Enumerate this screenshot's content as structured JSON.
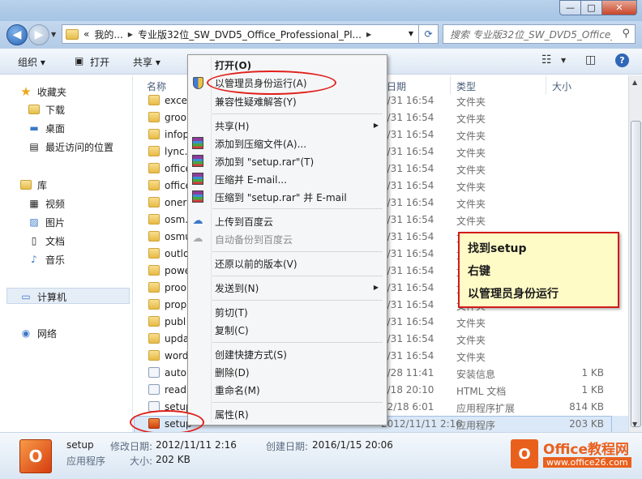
{
  "window": {
    "min": "—",
    "max": "□",
    "close": "✕"
  },
  "address": {
    "crumbs": [
      "«",
      "我的...",
      "专业版32位_SW_DVD5_Office_Professional_Pl..."
    ],
    "search_placeholder": "搜索 专业版32位_SW_DVD5_Office_..."
  },
  "toolbar": {
    "organize": "组织 ▾",
    "open": "打开",
    "share": "共享 ▾"
  },
  "sidebar": {
    "favorites": "收藏夹",
    "downloads": "下载",
    "desktop": "桌面",
    "recent": "最近访问的位置",
    "libraries": "库",
    "videos": "视频",
    "pictures": "图片",
    "documents": "文档",
    "music": "音乐",
    "computer": "计算机",
    "network": "网络"
  },
  "columns": {
    "name": "名称",
    "date": "日期",
    "type": "类型",
    "size": "大小"
  },
  "files": [
    {
      "name": "exce",
      "date": "1/31 16:54",
      "type": "文件夹",
      "size": ""
    },
    {
      "name": "groo",
      "date": "1/31 16:54",
      "type": "文件夹",
      "size": ""
    },
    {
      "name": "infop",
      "date": "1/31 16:54",
      "type": "文件夹",
      "size": ""
    },
    {
      "name": "lync.",
      "date": "1/31 16:54",
      "type": "文件夹",
      "size": ""
    },
    {
      "name": "office",
      "date": "1/31 16:54",
      "type": "文件夹",
      "size": ""
    },
    {
      "name": "office",
      "date": "1/31 16:54",
      "type": "文件夹",
      "size": ""
    },
    {
      "name": "oner",
      "date": "1/31 16:54",
      "type": "文件夹",
      "size": ""
    },
    {
      "name": "osm.",
      "date": "1/31 16:54",
      "type": "文件夹",
      "size": ""
    },
    {
      "name": "osmu",
      "date": "1/31 16:54",
      "type": "文件夹",
      "size": ""
    },
    {
      "name": "outlo",
      "date": "1/31 16:54",
      "type": "文件夹",
      "size": ""
    },
    {
      "name": "powe",
      "date": "1/31 16:54",
      "type": "文件夹",
      "size": ""
    },
    {
      "name": "proo",
      "date": "1/31 16:54",
      "type": "文件夹",
      "size": ""
    },
    {
      "name": "prop",
      "date": "1/31 16:54",
      "type": "文件夹",
      "size": ""
    },
    {
      "name": "publ",
      "date": "1/31 16:54",
      "type": "文件夹",
      "size": ""
    },
    {
      "name": "upda",
      "date": "1/31 16:54",
      "type": "文件夹",
      "size": ""
    },
    {
      "name": "word",
      "date": "1/31 16:54",
      "type": "文件夹",
      "size": ""
    },
    {
      "name": "autor",
      "date": "3/28 11:41",
      "type": "安装信息",
      "size": "1 KB"
    },
    {
      "name": "read",
      "date": "3/18 20:10",
      "type": "HTML 文档",
      "size": "1 KB"
    },
    {
      "name": "setup",
      "date": "12/18 6:01",
      "type": "应用程序扩展",
      "size": "814 KB"
    },
    {
      "name": "setup",
      "date": "2012/11/11 2:16",
      "type": "应用程序",
      "size": "203 KB"
    }
  ],
  "context_menu": {
    "open": "打开(O)",
    "run_as_admin": "以管理员身份运行(A)",
    "troubleshoot": "兼容性疑难解答(Y)",
    "share": "共享(H)",
    "add_archive": "添加到压缩文件(A)...",
    "add_setup_rar": "添加到 \"setup.rar\"(T)",
    "compress_email": "压缩并 E-mail...",
    "compress_setup_email": "压缩到 \"setup.rar\" 并 E-mail",
    "upload_baidu": "上传到百度云",
    "backup_baidu": "自动备份到百度云",
    "restore": "还原以前的版本(V)",
    "send_to": "发送到(N)",
    "cut": "剪切(T)",
    "copy": "复制(C)",
    "shortcut": "创建快捷方式(S)",
    "delete": "删除(D)",
    "rename": "重命名(M)",
    "properties": "属性(R)"
  },
  "callout": {
    "line1": "找到setup",
    "line2": "右键",
    "line3": "以管理员身份运行"
  },
  "details": {
    "name": "setup",
    "modified_label": "修改日期:",
    "modified_value": "2012/11/11 2:16",
    "created_label": "创建日期:",
    "created_value": "2016/1/15 20:06",
    "type": "应用程序",
    "size_label": "大小:",
    "size_value": "202 KB"
  },
  "watermark": {
    "title": "Office教程网",
    "url": "www.office26.com"
  },
  "colors": {
    "accent": "#2f67b7",
    "annotation": "#e0201b",
    "callout_bg": "#fffbc6",
    "brand": "#e9601d"
  }
}
